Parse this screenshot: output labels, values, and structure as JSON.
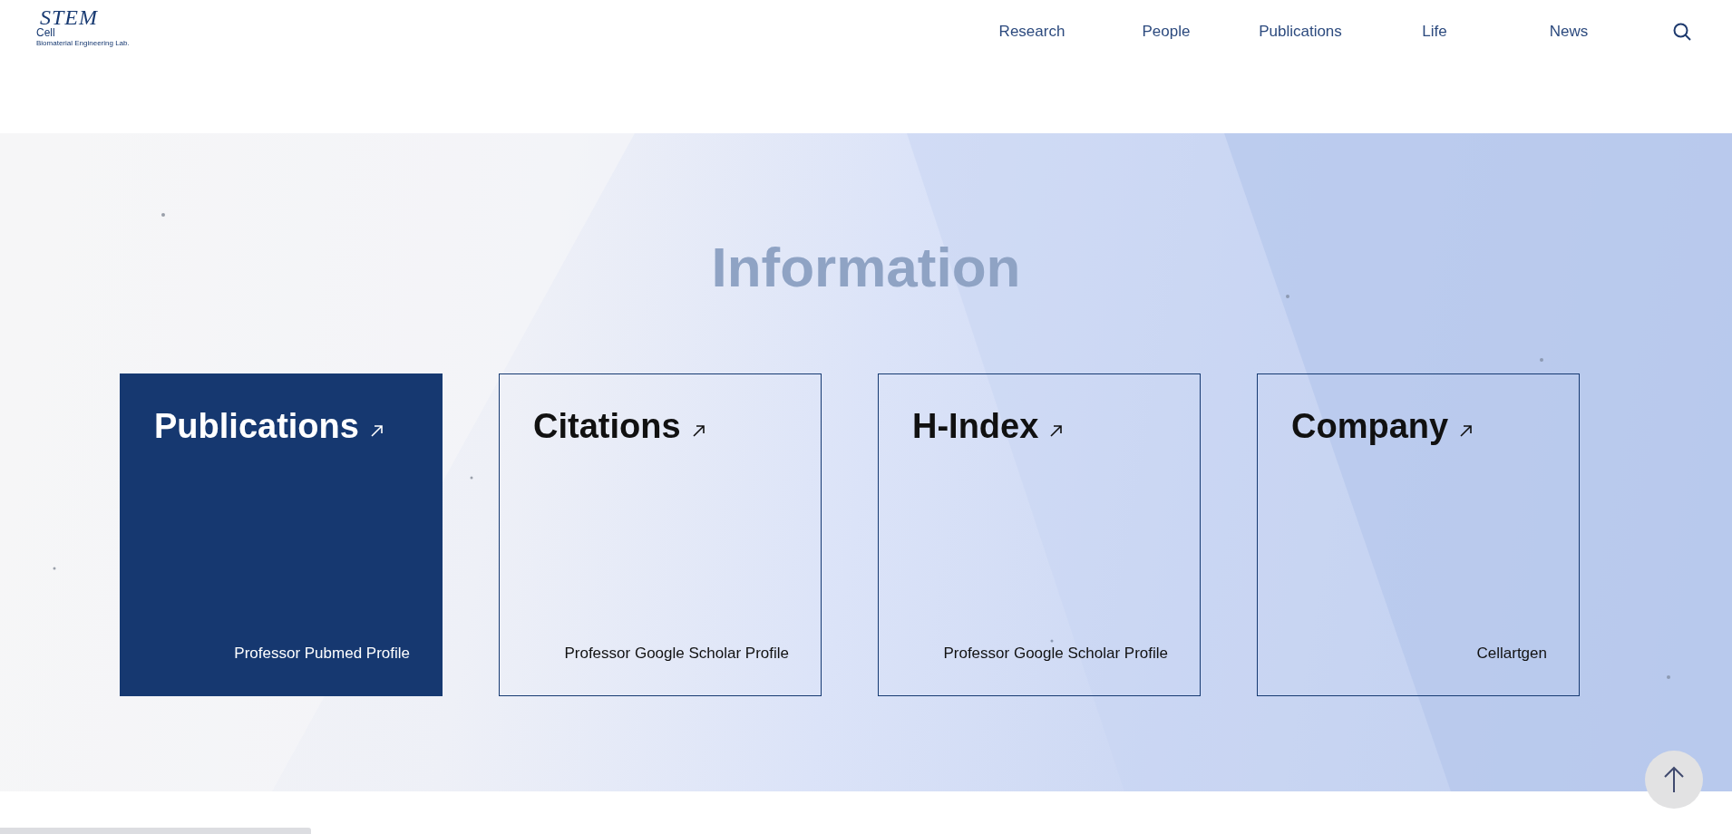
{
  "logo": {
    "mark": "STEM",
    "name": "Cell",
    "subtitle": "Biomaterial Engineering Lab."
  },
  "nav": [
    {
      "label": "Research"
    },
    {
      "label": "People"
    },
    {
      "label": "Publications"
    },
    {
      "label": "Life"
    },
    {
      "label": "News"
    }
  ],
  "section": {
    "title": "Information"
  },
  "cards": [
    {
      "title": "Publications",
      "caption": "Professor Pubmed Profile",
      "selected": true
    },
    {
      "title": "Citations",
      "caption": "Professor Google Scholar Profile",
      "selected": false
    },
    {
      "title": "H-Index",
      "caption": "Professor Google Scholar Profile",
      "selected": false
    },
    {
      "title": "Company",
      "caption": "Cellartgen",
      "selected": false
    }
  ]
}
